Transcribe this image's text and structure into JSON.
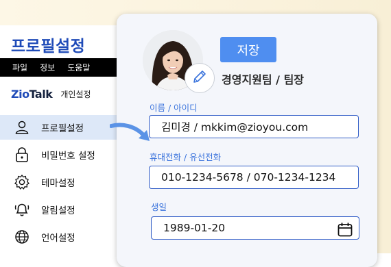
{
  "app": {
    "title": "프로필설정",
    "menu": [
      "파일",
      "정보",
      "도움말"
    ],
    "brand_logo_z": "Zio",
    "brand_logo_rest": "Talk",
    "brand_sub": "개인설정"
  },
  "sidebar": {
    "items": [
      {
        "label": "프로필설정",
        "icon": "user-icon",
        "active": true
      },
      {
        "label": "비밀번호 설정",
        "icon": "lock-icon",
        "active": false
      },
      {
        "label": "테마설정",
        "icon": "gear-icon",
        "active": false
      },
      {
        "label": "알림설정",
        "icon": "bell-icon",
        "active": false
      },
      {
        "label": "언어설정",
        "icon": "globe-icon",
        "active": false
      }
    ]
  },
  "profile": {
    "save_label": "저장",
    "team": "경영지원팀 / 팀장",
    "name_label": "이름 / 아이디",
    "name_value": "김미경 / mkkim@zioyou.com",
    "phone_label": "휴대전화 / 유선전화",
    "phone_value": "010-1234-5678 / 070-1234-1234",
    "birth_label": "생일",
    "birth_value": "1989-01-20"
  },
  "colors": {
    "accent": "#1f4bb8",
    "button": "#4f8ef0",
    "active_bg": "#dde8f8",
    "label": "#3a73dc"
  }
}
